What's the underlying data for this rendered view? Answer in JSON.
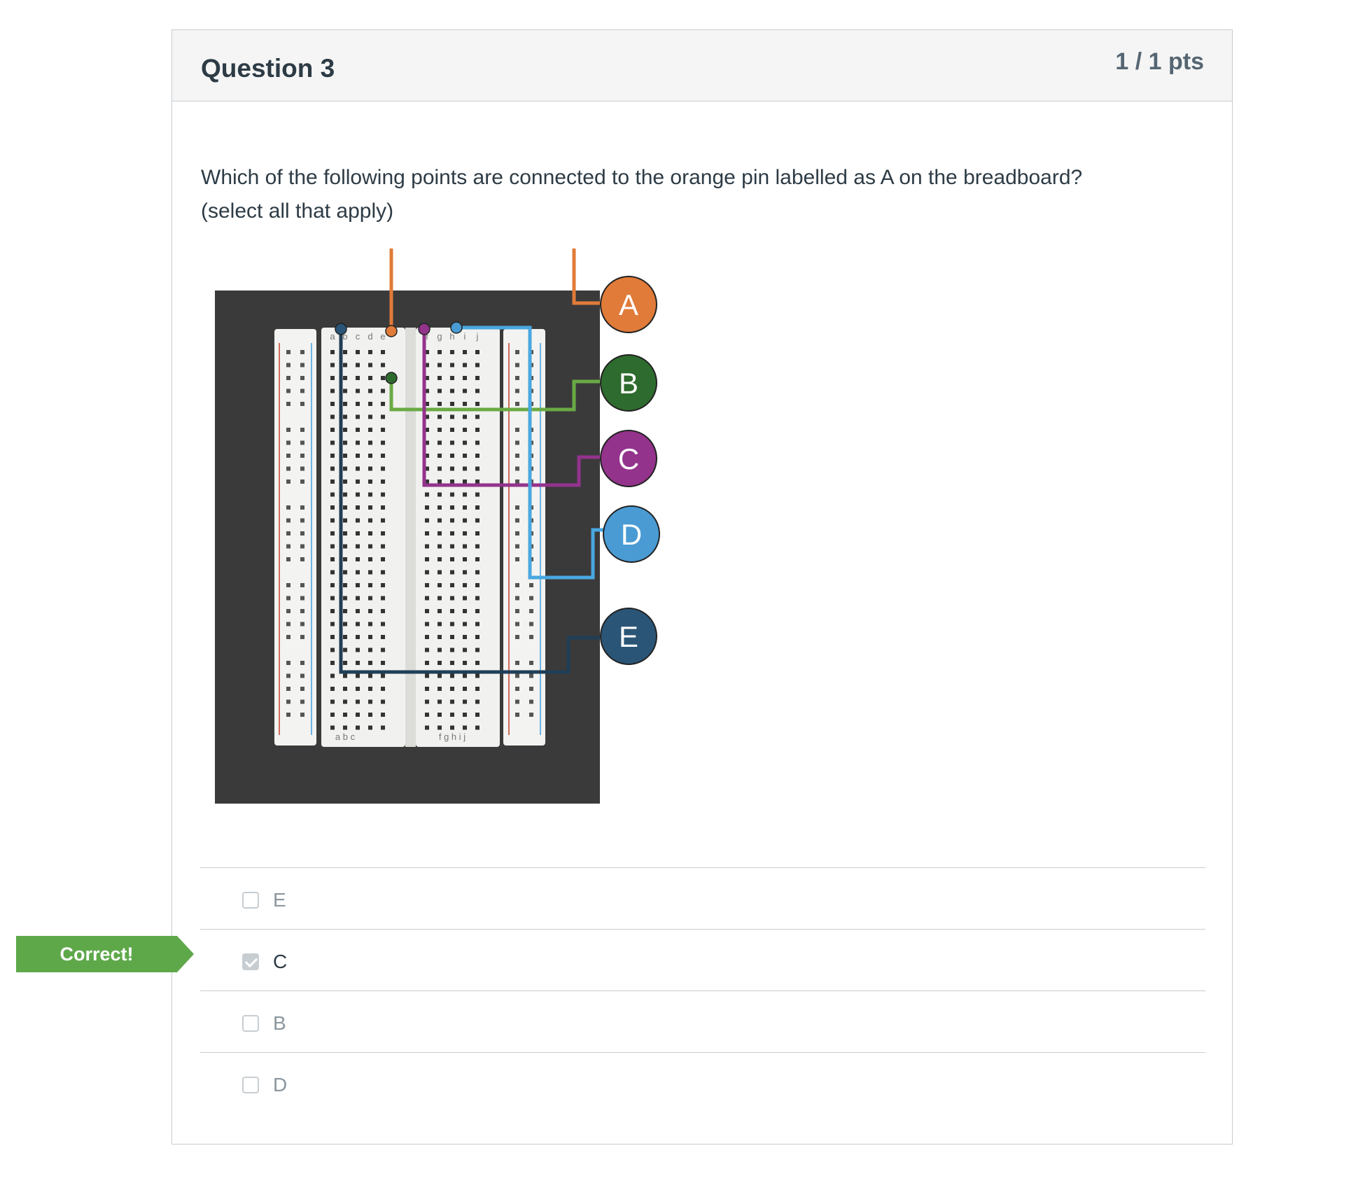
{
  "question": {
    "title": "Question 3",
    "points": "1 / 1 pts",
    "text_line1": "Which of the following points are connected to the orange pin labelled as A on the breadboard?",
    "text_line2": "(select all that apply)"
  },
  "diagram": {
    "breadboard_top_letters": [
      "a",
      "b",
      "c",
      "d",
      "e",
      "f",
      "g",
      "h",
      "i",
      "j"
    ],
    "breadboard_bottom_left": "a b c",
    "breadboard_bottom_right": "f g h i j",
    "row_count": 30,
    "markers": [
      {
        "label": "A",
        "color": "#e07b39"
      },
      {
        "label": "B",
        "color": "#2e6b2e"
      },
      {
        "label": "C",
        "color": "#93338c"
      },
      {
        "label": "D",
        "color": "#4a9bd4"
      },
      {
        "label": "E",
        "color": "#2a5577"
      }
    ],
    "wire_colors": {
      "A": "#e07b39",
      "B": "#6aaa45",
      "C": "#93338c",
      "D": "#4aa8e0",
      "E": "#203e56"
    }
  },
  "answers": [
    {
      "label": "E",
      "checked": false
    },
    {
      "label": "C",
      "checked": true
    },
    {
      "label": "B",
      "checked": false
    },
    {
      "label": "D",
      "checked": false
    }
  ],
  "feedback": {
    "correct_label": "Correct!",
    "color": "#5ea84a"
  }
}
